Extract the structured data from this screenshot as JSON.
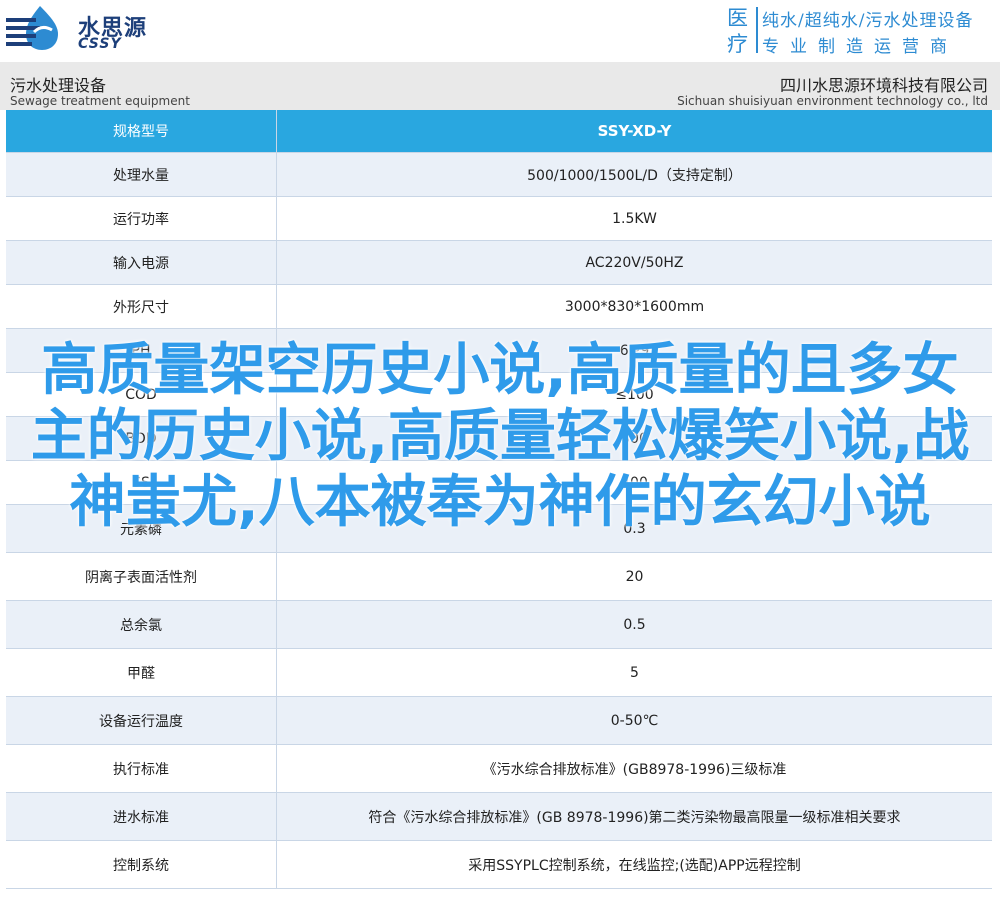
{
  "header": {
    "logo_cn": "水思源",
    "logo_en": "CSSY",
    "badge": "医疗",
    "tagline_top": "纯水/超纯水/污水处理设备",
    "tagline_bottom": "专业制造运营商"
  },
  "subheader": {
    "left_cn": "污水处理设备",
    "left_en": "Sewage treatment equipment",
    "right_cn": "四川水思源环境科技有限公司",
    "right_en": "Sichuan shuisiyuan environment technology co., ltd"
  },
  "colors": {
    "accent": "#29a7e0",
    "row_alt": "#eaf0f8",
    "overlay_text": "#2f9bea",
    "brand_dark": "#1d3f7a"
  },
  "table": {
    "header": {
      "label": "规格型号",
      "value": "SSY-XD-Y"
    },
    "rows": [
      {
        "label": "处理水量",
        "value": "500/1000/1500L/D（支持定制）"
      },
      {
        "label": "运行功率",
        "value": "1.5KW"
      },
      {
        "label": "输入电源",
        "value": "AC220V/50HZ"
      },
      {
        "label": "外形尺寸",
        "value": "3000*830*1600mm"
      },
      {
        "label": "PH",
        "value": "6~9"
      },
      {
        "label": "COD",
        "value": "≤100"
      },
      {
        "label": "BOD",
        "value": "300"
      },
      {
        "label": "SS",
        "value": "400"
      },
      {
        "label": "元素磷",
        "value": "0.3"
      },
      {
        "label": "阴离子表面活性剂",
        "value": "20"
      },
      {
        "label": "总余氯",
        "value": "0.5"
      },
      {
        "label": "甲醛",
        "value": "5"
      },
      {
        "label": "设备运行温度",
        "value": "0-50℃"
      },
      {
        "label": "执行标准",
        "value": "《污水综合排放标准》(GB8978-1996)三级标准"
      },
      {
        "label": "进水标准",
        "value": "符合《污水综合排放标准》(GB 8978-1996)第二类污染物最高限量一级标准相关要求"
      },
      {
        "label": "控制系统",
        "value": "采用SSYPLC控制系统，在线监控;(选配)APP远程控制"
      }
    ]
  },
  "overlay": {
    "headline": "高质量架空历史小说,高质量的且多女主的历史小说,高质量轻松爆笑小说,战神蚩尤,八本被奉为神作的玄幻小说"
  }
}
